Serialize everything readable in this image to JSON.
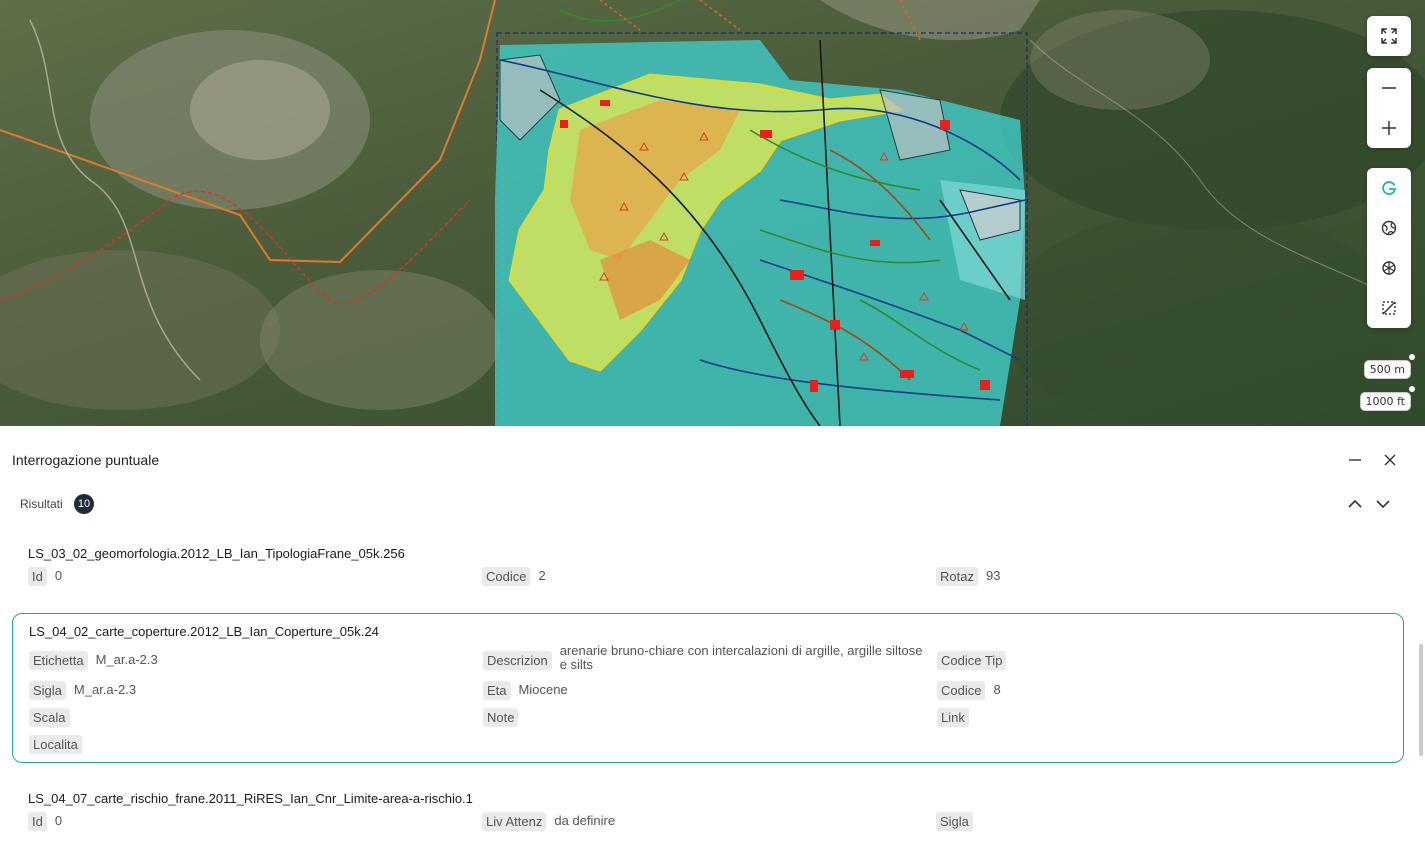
{
  "map": {
    "controls": {
      "fullscreen_icon": "expand-icon",
      "zoom_out_icon": "minus-icon",
      "zoom_in_icon": "plus-icon",
      "layer_icons": [
        "g-logo-icon",
        "globe-icon",
        "openai-icon",
        "selection-icon"
      ]
    },
    "scale": {
      "metric": "500 m",
      "imperial": "1000 ft"
    },
    "colors": {
      "active_tool": "#1db6a6"
    }
  },
  "panel": {
    "title": "Interrogazione puntuale",
    "minimize_icon": "minus-icon",
    "close_icon": "close-icon",
    "results_label": "Risultati",
    "results_count": "10",
    "prev_icon": "chevron-up-icon",
    "next_icon": "chevron-down-icon",
    "cards": [
      {
        "title": "LS_03_02_geomorfologia.2012_LB_Ian_TipologiaFrane_05k.256",
        "rows": [
          [
            {
              "label": "Id",
              "value": "0"
            },
            {
              "label": "Codice",
              "value": "2"
            },
            {
              "label": "Rotaz",
              "value": "93"
            }
          ]
        ]
      },
      {
        "title": "LS_04_02_carte_coperture.2012_LB_Ian_Coperture_05k.24",
        "rows": [
          [
            {
              "label": "Etichetta",
              "value": "M_ar.a-2.3"
            },
            {
              "label": "Descrizion",
              "value": "arenarie bruno-chiare con intercalazioni di argille, argille siltose e silts"
            },
            {
              "label": "Codice Tip",
              "value": ""
            }
          ],
          [
            {
              "label": "Sigla",
              "value": "M_ar.a-2.3"
            },
            {
              "label": "Eta",
              "value": "Miocene"
            },
            {
              "label": "Codice",
              "value": "8"
            }
          ],
          [
            {
              "label": "Scala",
              "value": ""
            },
            {
              "label": "Note",
              "value": ""
            },
            {
              "label": "Link",
              "value": ""
            }
          ],
          [
            {
              "label": "Localita",
              "value": ""
            }
          ]
        ]
      },
      {
        "title": "LS_04_07_carte_rischio_frane.2011_RiRES_Ian_Cnr_Limite-area-a-rischio.1",
        "rows": [
          [
            {
              "label": "Id",
              "value": "0"
            },
            {
              "label": "Liv Attenz",
              "value": "da definire"
            },
            {
              "label": "Sigla",
              "value": ""
            }
          ]
        ]
      }
    ]
  }
}
